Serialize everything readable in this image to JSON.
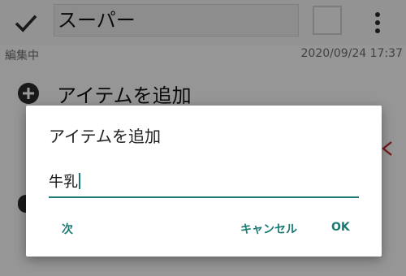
{
  "toolbar": {
    "title_value": "スーパー",
    "status": "編集中",
    "datetime": "2020/09/24 17:37"
  },
  "list": {
    "add_item_label": "アイテムを追加"
  },
  "dialog": {
    "title": "アイテムを追加",
    "input_value": "牛乳",
    "buttons": {
      "next": "次",
      "cancel": "キャンセル",
      "ok": "OK"
    }
  },
  "colors": {
    "accent": "#1b7a73",
    "delete": "#c62828",
    "scrim": "rgba(0,0,0,0.4)"
  },
  "icons": [
    "check-icon",
    "more-vert-icon",
    "add-circle-icon",
    "close-icon"
  ]
}
